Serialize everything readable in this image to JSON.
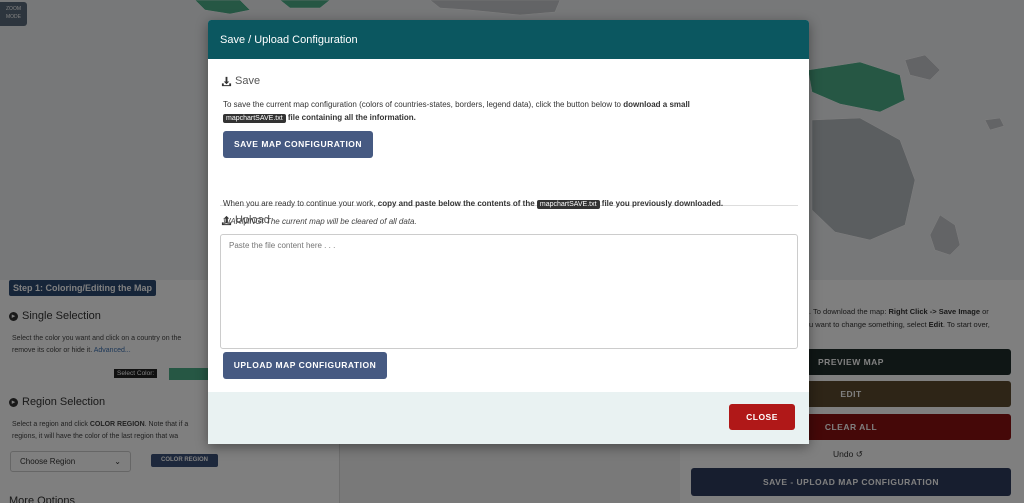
{
  "background": {
    "zoom_button": "ZOOM MODE",
    "step_badge": "Step 1: Coloring/Editing the Map",
    "single_selection": {
      "title": "Single Selection",
      "line1": "Select the color you want and click on a country on the",
      "line2_prefix": "remove its color or hide it.",
      "advanced_link": "Advanced..."
    },
    "select_color_label": "Select Color:",
    "region_selection": {
      "title": "Region Selection",
      "line1_prefix": "Select a region and click ",
      "line1_bold": "COLOR REGION",
      "line1_suffix": ". Note that if a",
      "line2": "regions, it will have the color of the last region that wa"
    },
    "choose_region": "Choose Region",
    "color_region_button": "COLOR REGION",
    "more_options": "More Options",
    "right_text_line1_prefix": ". To download the map: ",
    "right_text_line1_bold": "Right Click -> Save Image",
    "right_text_line1_suffix": " or",
    "right_text_line2_prefix": "u want to change something, select ",
    "right_text_line2_bold": "Edit",
    "right_text_line2_suffix": ". To start over,",
    "preview_map": "PREVIEW MAP",
    "edit": "EDIT",
    "clear_all": "CLEAR ALL",
    "undo": "Undo",
    "save_upload": "SAVE - UPLOAD MAP CONFIGURATION"
  },
  "modal": {
    "title": "Save / Upload Configuration",
    "save": {
      "heading": "Save",
      "line1_prefix": "To save the current map configuration (colors of countries-states, borders, legend data), click the button below to ",
      "line1_bold": "download a small",
      "filename": "mapchartSAVE.txt",
      "line2_bold": " file containing all the information.",
      "button": "SAVE MAP CONFIGURATION"
    },
    "upload": {
      "heading": "Upload",
      "line1_prefix": "When you are ready to continue your work, ",
      "line1_bold1": "copy and paste below the contents of the ",
      "filename": "mapchartSAVE.txt",
      "line1_bold2": " file you previously downloaded.",
      "warning": "WARNING! The current map will be cleared of all data.",
      "placeholder": "Paste the file content here . . .",
      "button": "UPLOAD MAP CONFIGURATION"
    },
    "close": "CLOSE"
  },
  "colors": {
    "header": "#0b5760",
    "primary_button": "#465a82",
    "close_button": "#b01818",
    "preview": "#1f2d2b",
    "edit": "#5c4a2e",
    "clear": "#8b1010",
    "save_upload": "#2f3c5e"
  }
}
